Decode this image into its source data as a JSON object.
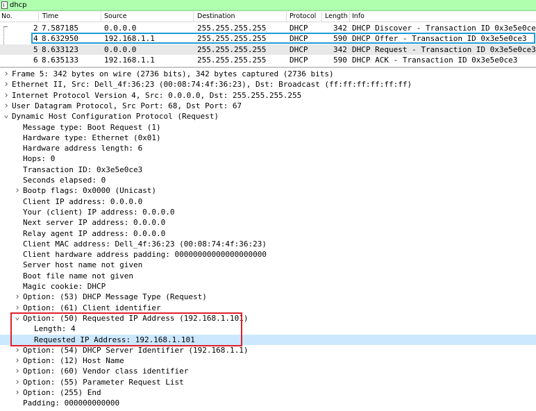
{
  "filter": {
    "text": "dhcp"
  },
  "packet_list": {
    "columns": [
      "No.",
      "Time",
      "Source",
      "Destination",
      "Protocol",
      "Length",
      "Info"
    ],
    "rows": [
      {
        "no": "2",
        "time": "7.587185",
        "source": "0.0.0.0",
        "destination": "255.255.255.255",
        "protocol": "DHCP",
        "length": "342",
        "info": "DHCP Discover  - Transaction ID 0x3e5e0ce3"
      },
      {
        "no": "4",
        "time": "8.632950",
        "source": "192.168.1.1",
        "destination": "255.255.255.255",
        "protocol": "DHCP",
        "length": "590",
        "info": "DHCP Offer     - Transaction ID 0x3e5e0ce3"
      },
      {
        "no": "5",
        "time": "8.633123",
        "source": "0.0.0.0",
        "destination": "255.255.255.255",
        "protocol": "DHCP",
        "length": "342",
        "info": "DHCP Request   - Transaction ID 0x3e5e0ce3"
      },
      {
        "no": "6",
        "time": "8.635133",
        "source": "192.168.1.1",
        "destination": "255.255.255.255",
        "protocol": "DHCP",
        "length": "590",
        "info": "DHCP ACK       - Transaction ID 0x3e5e0ce3"
      }
    ],
    "selected_index": 2
  },
  "details": [
    {
      "level": 0,
      "toggle": ">",
      "text": "Frame 5: 342 bytes on wire (2736 bits), 342 bytes captured (2736 bits)"
    },
    {
      "level": 0,
      "toggle": ">",
      "text": "Ethernet II, Src: Dell_4f:36:23 (00:08:74:4f:36:23), Dst: Broadcast (ff:ff:ff:ff:ff:ff)"
    },
    {
      "level": 0,
      "toggle": ">",
      "text": "Internet Protocol Version 4, Src: 0.0.0.0, Dst: 255.255.255.255"
    },
    {
      "level": 0,
      "toggle": ">",
      "text": "User Datagram Protocol, Src Port: 68, Dst Port: 67"
    },
    {
      "level": 0,
      "toggle": "v",
      "text": "Dynamic Host Configuration Protocol (Request)"
    },
    {
      "level": 1,
      "toggle": "",
      "text": "Message type: Boot Request (1)"
    },
    {
      "level": 1,
      "toggle": "",
      "text": "Hardware type: Ethernet (0x01)"
    },
    {
      "level": 1,
      "toggle": "",
      "text": "Hardware address length: 6"
    },
    {
      "level": 1,
      "toggle": "",
      "text": "Hops: 0"
    },
    {
      "level": 1,
      "toggle": "",
      "text": "Transaction ID: 0x3e5e0ce3"
    },
    {
      "level": 1,
      "toggle": "",
      "text": "Seconds elapsed: 0"
    },
    {
      "level": 1,
      "toggle": ">",
      "text": "Bootp flags: 0x0000 (Unicast)"
    },
    {
      "level": 1,
      "toggle": "",
      "text": "Client IP address: 0.0.0.0"
    },
    {
      "level": 1,
      "toggle": "",
      "text": "Your (client) IP address: 0.0.0.0"
    },
    {
      "level": 1,
      "toggle": "",
      "text": "Next server IP address: 0.0.0.0"
    },
    {
      "level": 1,
      "toggle": "",
      "text": "Relay agent IP address: 0.0.0.0"
    },
    {
      "level": 1,
      "toggle": "",
      "text": "Client MAC address: Dell_4f:36:23 (00:08:74:4f:36:23)"
    },
    {
      "level": 1,
      "toggle": "",
      "text": "Client hardware address padding: 00000000000000000000"
    },
    {
      "level": 1,
      "toggle": "",
      "text": "Server host name not given"
    },
    {
      "level": 1,
      "toggle": "",
      "text": "Boot file name not given"
    },
    {
      "level": 1,
      "toggle": "",
      "text": "Magic cookie: DHCP"
    },
    {
      "level": 1,
      "toggle": ">",
      "text": "Option: (53) DHCP Message Type (Request)"
    },
    {
      "level": 1,
      "toggle": ">",
      "text": "Option: (61) Client identifier"
    },
    {
      "level": 1,
      "toggle": "v",
      "text": "Option: (50) Requested IP Address (192.168.1.101)"
    },
    {
      "level": 2,
      "toggle": "",
      "text": "Length: 4"
    },
    {
      "level": 2,
      "toggle": "",
      "text": "Requested IP Address: 192.168.1.101",
      "highlight": true
    },
    {
      "level": 1,
      "toggle": ">",
      "text": "Option: (54) DHCP Server Identifier (192.168.1.1)"
    },
    {
      "level": 1,
      "toggle": ">",
      "text": "Option: (12) Host Name"
    },
    {
      "level": 1,
      "toggle": ">",
      "text": "Option: (60) Vendor class identifier"
    },
    {
      "level": 1,
      "toggle": ">",
      "text": "Option: (55) Parameter Request List"
    },
    {
      "level": 1,
      "toggle": ">",
      "text": "Option: (255) End"
    },
    {
      "level": 1,
      "toggle": "",
      "text": "Padding: 000000000000"
    }
  ],
  "colors": {
    "filter_bg": "#afffaf",
    "selection_outline": "#1f9bd7",
    "callout_outline": "#e01e2a",
    "highlight_bg": "#cce8ff"
  }
}
